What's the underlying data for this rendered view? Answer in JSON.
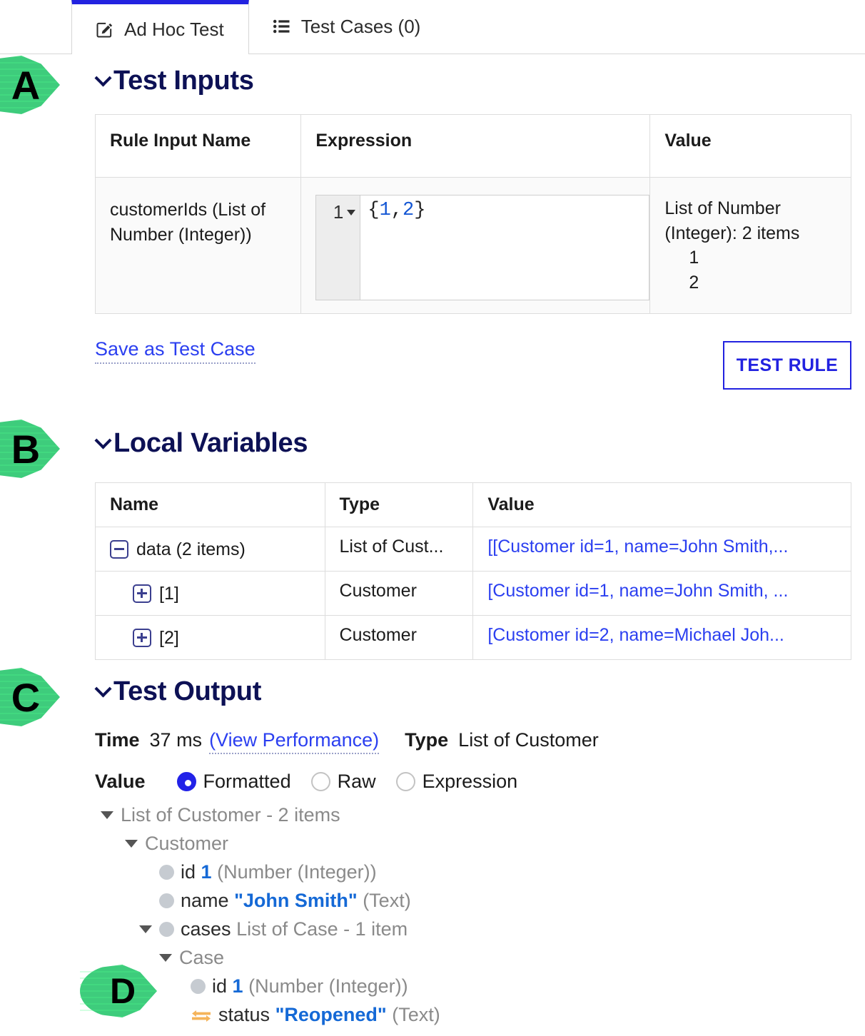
{
  "tabs": [
    {
      "label": "Ad Hoc Test",
      "icon": "pencil-square-icon",
      "active": true
    },
    {
      "label": "Test Cases (0)",
      "icon": "list-icon",
      "active": false
    }
  ],
  "callouts": [
    {
      "letter": "A"
    },
    {
      "letter": "B"
    },
    {
      "letter": "C"
    },
    {
      "letter": "D"
    }
  ],
  "sections": {
    "test_inputs": "Test Inputs",
    "local_variables": "Local Variables",
    "test_output": "Test Output"
  },
  "inputs_table": {
    "headers": [
      "Rule Input Name",
      "Expression",
      "Value"
    ],
    "row": {
      "name": "customerIds (List of Number (Integer))",
      "line_number": "1",
      "expression_prefix": "{",
      "expression_n1": "1",
      "expression_comma": ",",
      "expression_n2": "2",
      "expression_suffix": "}",
      "value_type": "List of Number (Integer): 2 items",
      "value_items": [
        "1",
        "2"
      ]
    }
  },
  "actions": {
    "save_as_test_case": "Save as Test Case",
    "test_rule": "TEST RULE"
  },
  "locals_table": {
    "headers": [
      "Name",
      "Type",
      "Value"
    ],
    "rows": [
      {
        "toggle": "minus",
        "indent": 0,
        "name": "data (2 items)",
        "type": "List of Cust...",
        "value": "[[Customer id=1, name=John Smith,..."
      },
      {
        "toggle": "plus",
        "indent": 1,
        "name": "[1]",
        "type": "Customer",
        "value": "[Customer id=1, name=John Smith, ..."
      },
      {
        "toggle": "plus",
        "indent": 1,
        "name": "[2]",
        "type": "Customer",
        "value": "[Customer id=2, name=Michael Joh..."
      }
    ]
  },
  "output": {
    "time_label": "Time",
    "time_value": "37 ms",
    "view_performance": "(View Performance)",
    "type_label": "Type",
    "type_value": "List of Customer",
    "value_label": "Value",
    "radios": [
      {
        "label": "Formatted",
        "selected": true
      },
      {
        "label": "Raw",
        "selected": false
      },
      {
        "label": "Expression",
        "selected": false
      }
    ],
    "tree": [
      {
        "indent": 0,
        "marker": "triangle",
        "text": "List of Customer - 2 items",
        "style": "gray"
      },
      {
        "indent": 1,
        "marker": "triangle",
        "text": "Customer",
        "style": "gray"
      },
      {
        "indent": 2,
        "marker": "dot",
        "name": "id",
        "value": "1",
        "type": "(Number (Integer))"
      },
      {
        "indent": 2,
        "marker": "dot",
        "name": "name",
        "value": "\"John Smith\"",
        "type": "(Text)"
      },
      {
        "indent": 3,
        "marker": "triangle-dot",
        "name": "cases",
        "value": "",
        "type": "List of Case - 1 item"
      },
      {
        "indent": 4,
        "marker": "triangle",
        "text": "Case",
        "style": "gray"
      },
      {
        "indent": 5,
        "marker": "dot",
        "name": "id",
        "value": "1",
        "type": "(Number (Integer))"
      },
      {
        "indent": 5,
        "marker": "swap",
        "name": "status",
        "value": "\"Reopened\"",
        "type": "(Text)"
      }
    ]
  },
  "colors": {
    "accent_blue": "#2222e0",
    "link_blue": "#2b3ff0",
    "heading_navy": "#0d1155",
    "callout_green": "#3ecc7c",
    "swap_orange": "#f5b45a",
    "value_blue": "#1569d6"
  }
}
